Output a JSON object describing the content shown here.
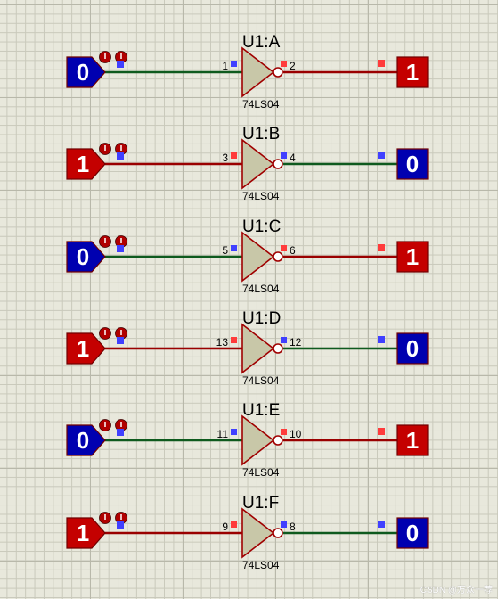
{
  "colors": {
    "wire": "#0e5a1e",
    "wire_red": "#9a0000",
    "logic_high": "#c40000",
    "logic_low": "#0000b0",
    "gate_fill": "#c8c7a8",
    "gate_stroke": "#a00000",
    "pin_blue": "#4040ff",
    "pin_red": "#ff3b3b",
    "probe_icon": "#b00000"
  },
  "gates": [
    {
      "label": "U1:A",
      "part": "74LS04",
      "pin_in": "1",
      "pin_out": "2",
      "input_value": "0",
      "output_value": "1"
    },
    {
      "label": "U1:B",
      "part": "74LS04",
      "pin_in": "3",
      "pin_out": "4",
      "input_value": "1",
      "output_value": "0"
    },
    {
      "label": "U1:C",
      "part": "74LS04",
      "pin_in": "5",
      "pin_out": "6",
      "input_value": "0",
      "output_value": "1"
    },
    {
      "label": "U1:D",
      "part": "74LS04",
      "pin_in": "13",
      "pin_out": "12",
      "input_value": "1",
      "output_value": "0"
    },
    {
      "label": "U1:E",
      "part": "74LS04",
      "pin_in": "11",
      "pin_out": "10",
      "input_value": "0",
      "output_value": "1"
    },
    {
      "label": "U1:F",
      "part": "74LS04",
      "pin_in": "9",
      "pin_out": "8",
      "input_value": "1",
      "output_value": "0"
    }
  ],
  "watermark": "CSDN @万众一荐"
}
